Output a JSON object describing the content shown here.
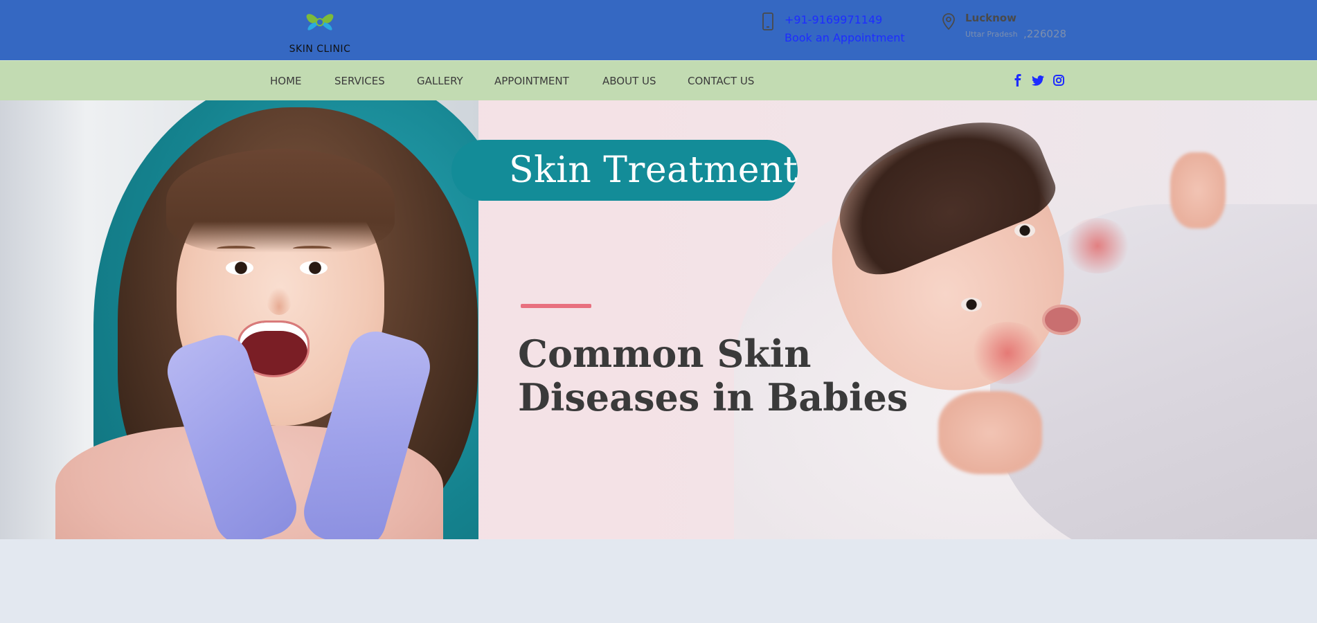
{
  "header": {
    "logo_text": "SKIN CLINIC",
    "phone": "+91-9169971149",
    "appointment_link": "Book an Appointment",
    "city": "Lucknow",
    "state": "Uttar Pradesh",
    "pincode": ",226028"
  },
  "nav": {
    "items": [
      {
        "label": "HOME"
      },
      {
        "label": "SERVICES"
      },
      {
        "label": "GALLERY"
      },
      {
        "label": "APPOINTMENT"
      },
      {
        "label": "ABOUT US"
      },
      {
        "label": "CONTACT US"
      }
    ],
    "social": [
      "facebook-icon",
      "twitter-icon",
      "instagram-icon"
    ]
  },
  "hero": {
    "badge_title": "Skin Treatment",
    "headline": "Common Skin Diseases in Babies"
  },
  "colors": {
    "topbar": "#3568c2",
    "navbar": "#c2dbb2",
    "link": "#1e2cff",
    "pill": "#138c98",
    "accent": "#e8707f"
  }
}
